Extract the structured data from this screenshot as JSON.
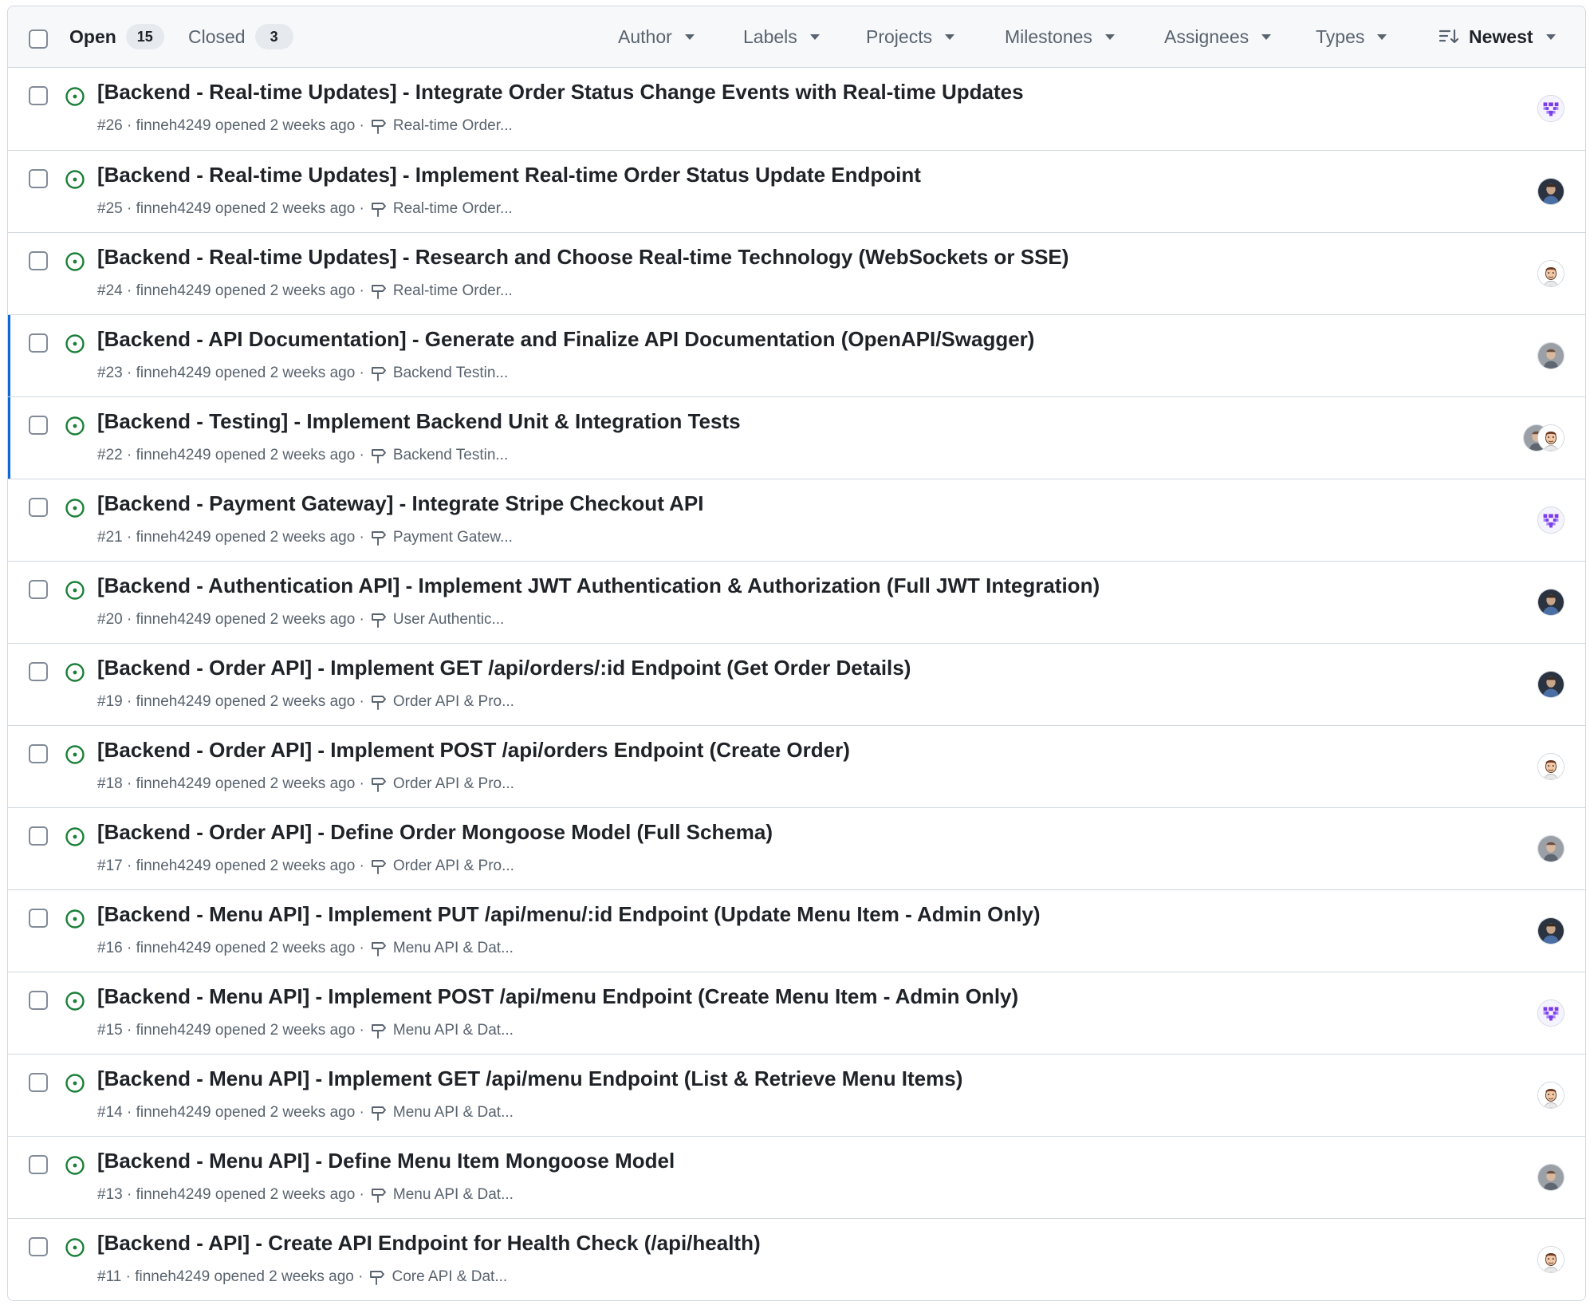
{
  "header": {
    "open_label": "Open",
    "open_count": "15",
    "closed_label": "Closed",
    "closed_count": "3",
    "filters": [
      "Author",
      "Labels",
      "Projects",
      "Milestones",
      "Assignees",
      "Types"
    ],
    "sort_label": "Newest"
  },
  "colors": {
    "open_icon": "#1a7f37",
    "accent_bar": "#0969da",
    "border": "#d1d9e0",
    "muted_text": "#59636e"
  },
  "issues": [
    {
      "title": "[Backend - Real-time Updates] - Integrate Order Status Change Events with Real-time Updates",
      "number": "#26",
      "opened": "finneh4249 opened 2 weeks ago",
      "milestone": "Real-time Order...",
      "avatars": [
        "purple-identicon"
      ],
      "marked": false
    },
    {
      "title": "[Backend - Real-time Updates] - Implement Real-time Order Status Update Endpoint",
      "number": "#25",
      "opened": "finneh4249 opened 2 weeks ago",
      "milestone": "Real-time Order...",
      "avatars": [
        "dark-photo"
      ],
      "marked": false
    },
    {
      "title": "[Backend - Real-time Updates] - Research and Choose Real-time Technology (WebSockets or SSE)",
      "number": "#24",
      "opened": "finneh4249 opened 2 weeks ago",
      "milestone": "Real-time Order...",
      "avatars": [
        "cartoon-face"
      ],
      "marked": false
    },
    {
      "title": "[Backend - API Documentation] - Generate and Finalize API Documentation (OpenAPI/Swagger)",
      "number": "#23",
      "opened": "finneh4249 opened 2 weeks ago",
      "milestone": "Backend Testin...",
      "avatars": [
        "grey-photo"
      ],
      "marked": true
    },
    {
      "title": "[Backend - Testing] - Implement Backend Unit & Integration Tests",
      "number": "#22",
      "opened": "finneh4249 opened 2 weeks ago",
      "milestone": "Backend Testin...",
      "avatars": [
        "grey-photo",
        "cartoon-face"
      ],
      "marked": true
    },
    {
      "title": "[Backend - Payment Gateway] - Integrate Stripe Checkout API",
      "number": "#21",
      "opened": "finneh4249 opened 2 weeks ago",
      "milestone": "Payment Gatew...",
      "avatars": [
        "purple-identicon"
      ],
      "marked": false
    },
    {
      "title": "[Backend - Authentication API] - Implement JWT Authentication & Authorization (Full JWT Integration)",
      "number": "#20",
      "opened": "finneh4249 opened 2 weeks ago",
      "milestone": "User Authentic...",
      "avatars": [
        "dark-photo"
      ],
      "marked": false
    },
    {
      "title": "[Backend - Order API] - Implement GET /api/orders/:id Endpoint (Get Order Details)",
      "number": "#19",
      "opened": "finneh4249 opened 2 weeks ago",
      "milestone": "Order API & Pro...",
      "avatars": [
        "dark-photo"
      ],
      "marked": false
    },
    {
      "title": "[Backend - Order API] - Implement POST /api/orders Endpoint (Create Order)",
      "number": "#18",
      "opened": "finneh4249 opened 2 weeks ago",
      "milestone": "Order API & Pro...",
      "avatars": [
        "cartoon-face"
      ],
      "marked": false
    },
    {
      "title": "[Backend - Order API] - Define Order Mongoose Model (Full Schema)",
      "number": "#17",
      "opened": "finneh4249 opened 2 weeks ago",
      "milestone": "Order API & Pro...",
      "avatars": [
        "grey-photo"
      ],
      "marked": false
    },
    {
      "title": "[Backend - Menu API] - Implement PUT /api/menu/:id Endpoint (Update Menu Item - Admin Only)",
      "number": "#16",
      "opened": "finneh4249 opened 2 weeks ago",
      "milestone": "Menu API & Dat...",
      "avatars": [
        "dark-photo"
      ],
      "marked": false
    },
    {
      "title": "[Backend - Menu API] - Implement POST /api/menu Endpoint (Create Menu Item - Admin Only)",
      "number": "#15",
      "opened": "finneh4249 opened 2 weeks ago",
      "milestone": "Menu API & Dat...",
      "avatars": [
        "purple-identicon"
      ],
      "marked": false
    },
    {
      "title": "[Backend - Menu API] - Implement GET /api/menu Endpoint (List & Retrieve Menu Items)",
      "number": "#14",
      "opened": "finneh4249 opened 2 weeks ago",
      "milestone": "Menu API & Dat...",
      "avatars": [
        "cartoon-face"
      ],
      "marked": false
    },
    {
      "title": "[Backend - Menu API] - Define Menu Item Mongoose Model",
      "number": "#13",
      "opened": "finneh4249 opened 2 weeks ago",
      "milestone": "Menu API & Dat...",
      "avatars": [
        "grey-photo"
      ],
      "marked": false
    },
    {
      "title": "[Backend - API] - Create API Endpoint for Health Check (/api/health)",
      "number": "#11",
      "opened": "finneh4249 opened 2 weeks ago",
      "milestone": "Core API & Dat...",
      "avatars": [
        "cartoon-face"
      ],
      "marked": false
    }
  ]
}
